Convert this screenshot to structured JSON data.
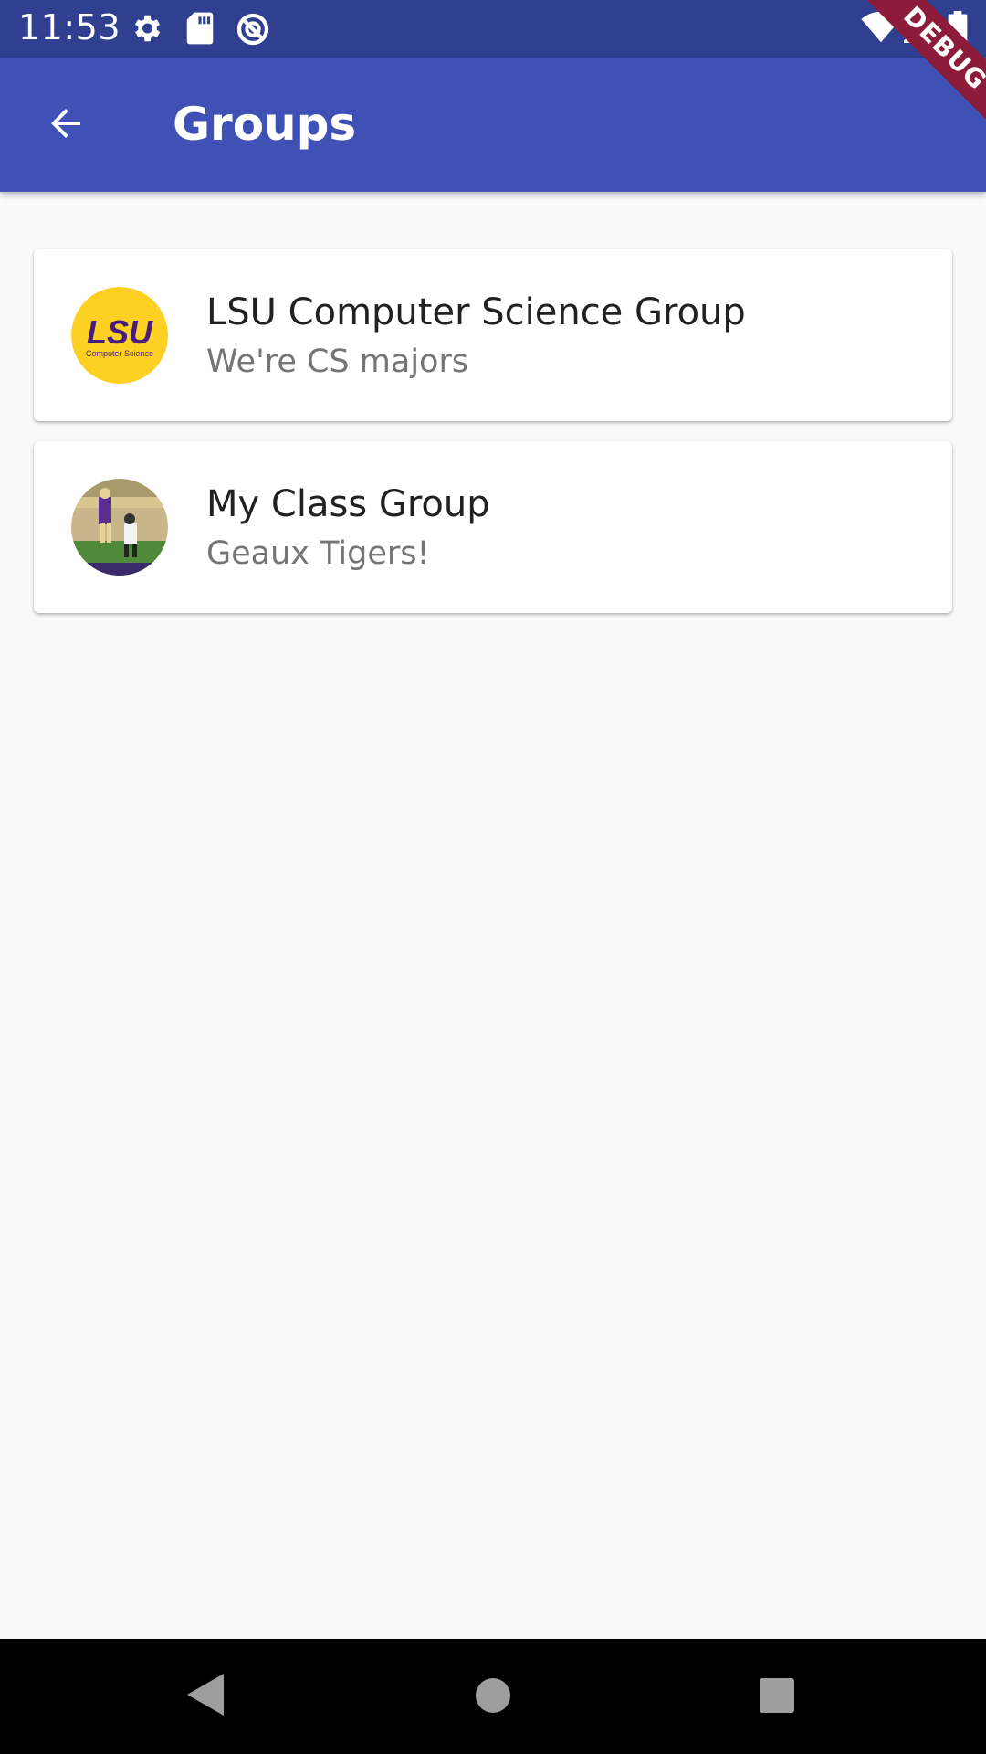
{
  "status_bar": {
    "time": "11:53",
    "icons": [
      "settings-icon",
      "sd-card-icon",
      "data-saver-icon",
      "wifi-icon",
      "signal-icon",
      "battery-icon"
    ]
  },
  "debug_banner": "DEBUG",
  "app_bar": {
    "title": "Groups",
    "back_icon": "arrow-back-icon",
    "background": "#3f51b5"
  },
  "groups": [
    {
      "title": "LSU Computer Science Group",
      "subtitle": "We're CS majors",
      "avatar": {
        "type": "logo",
        "text": "LSU",
        "caption": "Computer Science",
        "bg": "#fdd023",
        "fg": "#461d7c"
      }
    },
    {
      "title": "My Class Group",
      "subtitle": "Geaux Tigers!",
      "avatar": {
        "type": "photo",
        "description_icon": "football-photo"
      }
    }
  ],
  "nav_bar": {
    "buttons": [
      "back-icon",
      "home-icon",
      "recents-icon"
    ]
  }
}
